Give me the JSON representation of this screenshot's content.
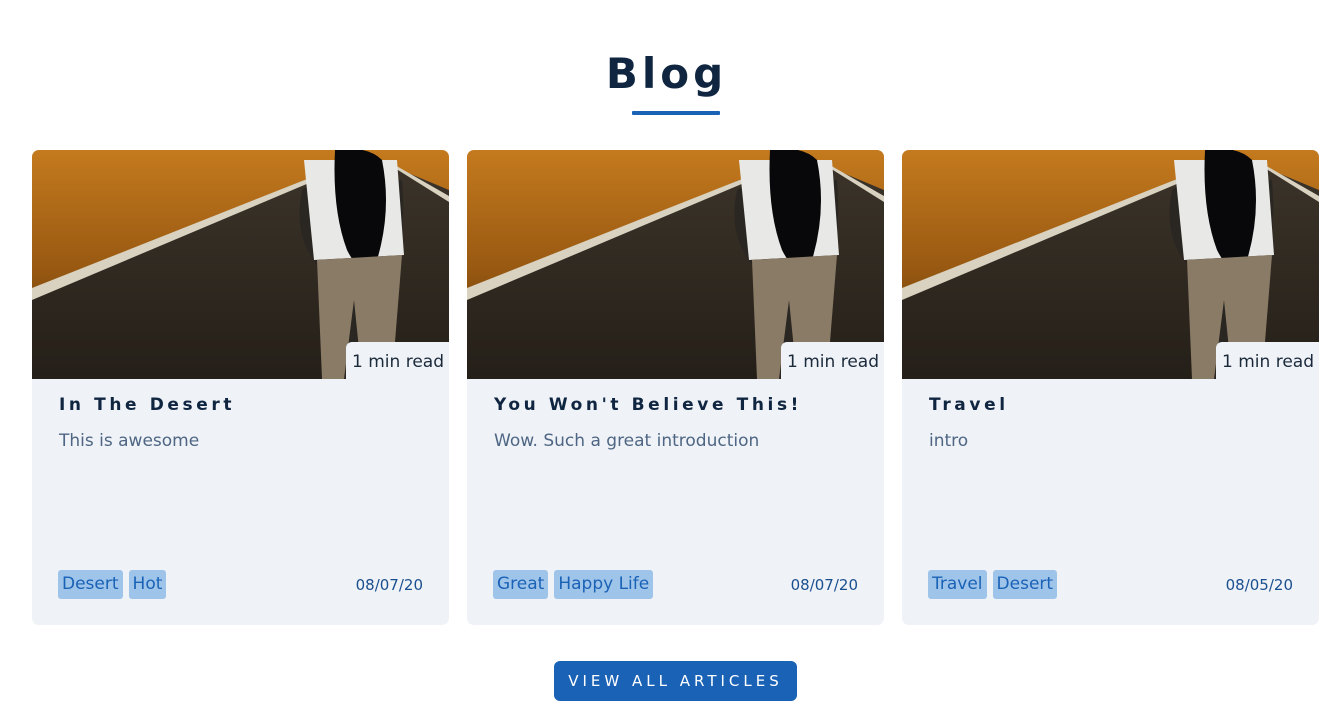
{
  "section": {
    "title": "Blog"
  },
  "posts": [
    {
      "title": "In The Desert",
      "intro": "This is awesome",
      "read_time": "1 min read",
      "date": "08/07/20",
      "tags": [
        "Desert",
        "Hot"
      ]
    },
    {
      "title": "You Won't Believe This!",
      "intro": "Wow. Such a great introduction",
      "read_time": "1 min read",
      "date": "08/07/20",
      "tags": [
        "Great",
        "Happy Life"
      ]
    },
    {
      "title": "Travel",
      "intro": "intro",
      "read_time": "1 min read",
      "date": "08/05/20",
      "tags": [
        "Travel",
        "Desert"
      ]
    }
  ],
  "view_all_label": "VIEW ALL ARTICLES",
  "colors": {
    "primary": "#1a62b6",
    "heading": "#0f2540",
    "card_bg": "#eff2f7",
    "tag_bg": "#9fc4ea"
  }
}
